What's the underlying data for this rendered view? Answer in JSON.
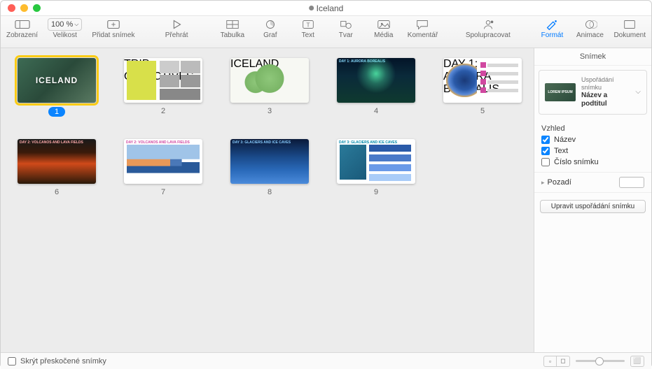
{
  "window": {
    "title": "Iceland"
  },
  "toolbar": {
    "view": "Zobrazení",
    "zoom_value": "100 %",
    "zoom_label": "Velikost",
    "add_slide": "Přidat snímek",
    "play": "Přehrát",
    "table": "Tabulka",
    "chart": "Graf",
    "text": "Text",
    "shape": "Tvar",
    "media": "Média",
    "comment": "Komentář",
    "collaborate": "Spolupracovat",
    "format": "Formát",
    "animate": "Animace",
    "document": "Dokument"
  },
  "slides": [
    {
      "num": "1",
      "title": "ICELAND",
      "caption": ""
    },
    {
      "num": "2",
      "title": "",
      "caption": "TRIP OBJECTIVES"
    },
    {
      "num": "3",
      "title": "",
      "caption": "ICELAND"
    },
    {
      "num": "4",
      "title": "",
      "caption": "DAY 1: AURORA BOREALIS"
    },
    {
      "num": "5",
      "title": "",
      "caption": "DAY 1: AURORA BOREALIS"
    },
    {
      "num": "6",
      "title": "",
      "caption": "DAY 2: VOLCANOS AND LAVA FIELDS"
    },
    {
      "num": "7",
      "title": "",
      "caption": "DAY 2: VOLCANOS AND LAVA FIELDS"
    },
    {
      "num": "8",
      "title": "",
      "caption": "DAY 3: GLACIERS AND ICE CAVES"
    },
    {
      "num": "9",
      "title": "",
      "caption": "DAY 3: GLACIERS AND ICE CAVES"
    }
  ],
  "inspector": {
    "panel_title": "Snímek",
    "layout_thumb_text": "LOREM IPSUM",
    "layout_sub": "Uspořádání snímku",
    "layout_main": "Název a podtitul",
    "appearance_header": "Vzhled",
    "check_title": "Název",
    "check_text": "Text",
    "check_slide_number": "Číslo snímku",
    "background_label": "Pozadí",
    "edit_layout_button": "Upravit uspořádání snímku"
  },
  "bottom": {
    "skip_label": "Skrýt přeskočené snímky"
  }
}
